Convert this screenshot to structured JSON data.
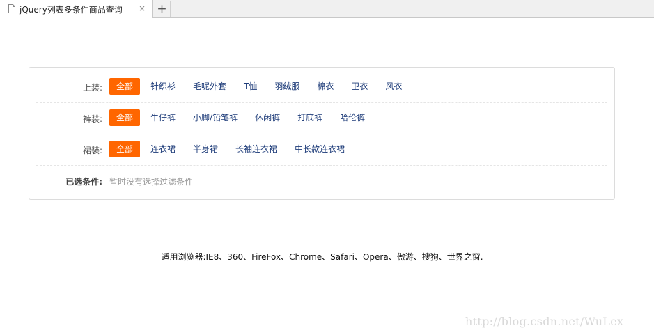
{
  "tab": {
    "title": "jQuery列表多条件商品查询",
    "close_glyph": "×",
    "new_tab_glyph": "+"
  },
  "filters": [
    {
      "label": "上装:",
      "options": [
        "全部",
        "针织衫",
        "毛呢外套",
        "T恤",
        "羽绒服",
        "棉衣",
        "卫衣",
        "风衣"
      ],
      "active": "全部"
    },
    {
      "label": "裤装:",
      "options": [
        "全部",
        "牛仔裤",
        "小脚/铅笔裤",
        "休闲裤",
        "打底裤",
        "哈伦裤"
      ],
      "active": "全部"
    },
    {
      "label": "裙装:",
      "options": [
        "全部",
        "连衣裙",
        "半身裙",
        "长袖连衣裙",
        "中长款连衣裙"
      ],
      "active": "全部"
    }
  ],
  "selected": {
    "label": "已选条件:",
    "empty_text": "暂时没有选择过滤条件"
  },
  "footer": {
    "note": "适用浏览器:IE8、360、FireFox、Chrome、Safari、Opera、傲游、搜狗、世界之窗."
  },
  "watermark": "http://blog.csdn.net/WuLex",
  "colors": {
    "accent": "#ff6600",
    "link": "#1f3d7a"
  }
}
